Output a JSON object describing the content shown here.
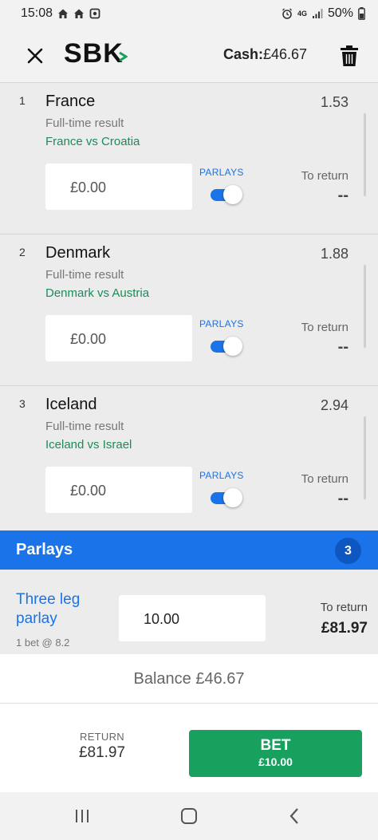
{
  "status_bar": {
    "time": "15:08",
    "network": "4G",
    "battery": "50%"
  },
  "header": {
    "logo": "SBK",
    "cash_label": "Cash:",
    "cash_value": "£46.67"
  },
  "selections": [
    {
      "number": "1",
      "team": "France",
      "odds": "1.53",
      "market": "Full-time result",
      "event": "France vs Croatia",
      "stake": "£0.00",
      "parlays_label": "PARLAYS",
      "parlay_enabled": true,
      "to_return_label": "To return",
      "to_return_value": "--"
    },
    {
      "number": "2",
      "team": "Denmark",
      "odds": "1.88",
      "market": "Full-time result",
      "event": "Denmark vs Austria",
      "stake": "£0.00",
      "parlays_label": "PARLAYS",
      "parlay_enabled": true,
      "to_return_label": "To return",
      "to_return_value": "--"
    },
    {
      "number": "3",
      "team": "Iceland",
      "odds": "2.94",
      "market": "Full-time result",
      "event": "Iceland vs Israel",
      "stake": "£0.00",
      "parlays_label": "PARLAYS",
      "parlay_enabled": true,
      "to_return_label": "To return",
      "to_return_value": "--"
    }
  ],
  "parlays": {
    "title": "Parlays",
    "count": "3",
    "name": "Three leg parlay",
    "sub": "1 bet @ 8.2",
    "stake": "10.00",
    "to_return_label": "To return",
    "to_return_value": "£81.97"
  },
  "balance": "Balance £46.67",
  "footer": {
    "return_label": "RETURN",
    "return_value": "£81.97",
    "bet_label": "BET",
    "bet_amount": "£10.00"
  },
  "colors": {
    "accent_blue": "#1a73e8",
    "bet_green": "#18a05f",
    "event_green": "#1e8a5a"
  }
}
